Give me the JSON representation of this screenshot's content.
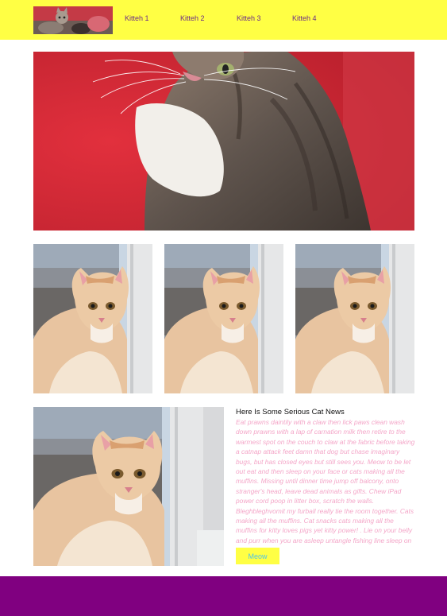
{
  "nav": {
    "logo_icon": "kitten-photo-icon",
    "links": [
      "Kitteh 1",
      "Kitteh 2",
      "Kitteh 3",
      "Kitteh 4"
    ]
  },
  "images": {
    "hero": "tabby-kitten-photo",
    "thumbs": [
      "ginger-kitten-photo",
      "ginger-kitten-photo",
      "ginger-kitten-photo"
    ],
    "feature": "ginger-kitten-photo"
  },
  "news": {
    "title": "Here Is Some Serious Cat News",
    "body": "Eat prawns daintily with a claw then lick paws clean wash down prawns with a lap of carnation milk then retire to the warmest spot on the couch to claw at the fabric before taking a catnap attack feet damn that dog but chase imaginary bugs, but has closed eyes but still sees you. Meow to be let out eat and then sleep on your face or cats making all the muffins. Missing until dinner time jump off balcony, onto stranger's head, leave dead animals as gifts. Chew iPad power cord poop in litter box, scratch the walls. Bleghbleghvomit my furball really tie the room together. Cats making all the muffins. Cat snacks cats making all the muffins for kitty loves pigs yet kitty power! . Lie on your belly and purr when you are asleep untangle fishing line sleep on keyboard",
    "button_label": "Meow"
  },
  "colors": {
    "header_bg": "#ffff44",
    "footer_bg": "#800080",
    "nav_text": "#6b2a86",
    "news_text": "#f4a6c8",
    "button_text": "#4fc3e8"
  }
}
